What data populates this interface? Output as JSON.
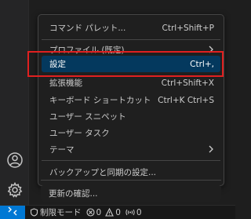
{
  "menu": {
    "items": [
      {
        "label": "コマンド パレット...",
        "shortcut": "Ctrl+Shift+P"
      },
      {
        "label": "プロファイル (既定)",
        "submenu": true
      },
      {
        "label": "設定",
        "shortcut": "Ctrl+,",
        "selected": true
      },
      {
        "label": "拡張機能",
        "shortcut": "Ctrl+Shift+X"
      },
      {
        "label": "キーボード ショートカット",
        "shortcut": "Ctrl+K Ctrl+S"
      },
      {
        "label": "ユーザー スニペット"
      },
      {
        "label": "ユーザー タスク"
      },
      {
        "label": "テーマ",
        "submenu": true
      },
      {
        "label": "バックアップと同期の設定..."
      },
      {
        "label": "更新の確認..."
      }
    ]
  },
  "status_bar": {
    "remote_icon": "remote-icon",
    "restricted_mode": "制限モード",
    "errors": "0",
    "warnings": "0",
    "ports": "0"
  },
  "colors": {
    "selection": "#04395e",
    "highlight_border": "#e02020",
    "remote_button": "#0078d4"
  }
}
